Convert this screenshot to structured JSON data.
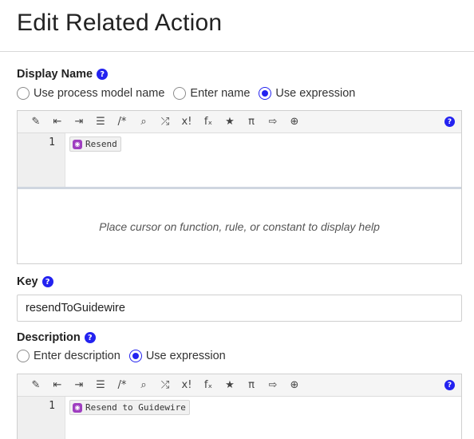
{
  "page": {
    "title": "Edit Related Action"
  },
  "display_name": {
    "label": "Display Name",
    "help": "?",
    "options": [
      "Use process model name",
      "Enter name",
      "Use expression"
    ],
    "selected": "Use expression",
    "editor": {
      "line_number": "1",
      "token_icon": "rule-icon",
      "token_text": "Resend",
      "help_text": "Place cursor on function, rule, or constant to display help"
    }
  },
  "key": {
    "label": "Key",
    "help": "?",
    "value": "resendToGuidewire"
  },
  "description": {
    "label": "Description",
    "help": "?",
    "options": [
      "Enter description",
      "Use expression"
    ],
    "selected": "Use expression",
    "editor": {
      "line_number": "1",
      "token_icon": "rule-icon",
      "token_text": "Resend to Guidewire"
    }
  },
  "toolbar": {
    "icons": [
      {
        "name": "magic-wand-icon",
        "glyph": "✎"
      },
      {
        "name": "outdent-icon",
        "glyph": "⇤"
      },
      {
        "name": "indent-icon",
        "glyph": "⇥"
      },
      {
        "name": "list-icon",
        "glyph": "☰"
      },
      {
        "name": "comment-icon",
        "glyph": "/*"
      },
      {
        "name": "search-icon",
        "glyph": "⌕"
      },
      {
        "name": "shuffle-icon",
        "glyph": "⤮"
      },
      {
        "name": "variable-icon",
        "glyph": "x!"
      },
      {
        "name": "function-icon",
        "glyph": "fₓ"
      },
      {
        "name": "star-icon",
        "glyph": "★"
      },
      {
        "name": "pi-icon",
        "glyph": "π"
      },
      {
        "name": "export-icon",
        "glyph": "⇨"
      },
      {
        "name": "globe-icon",
        "glyph": "⊕"
      }
    ],
    "help": "?"
  },
  "colors": {
    "accent": "#2322f0",
    "token_icon": "#9f3ec0"
  }
}
